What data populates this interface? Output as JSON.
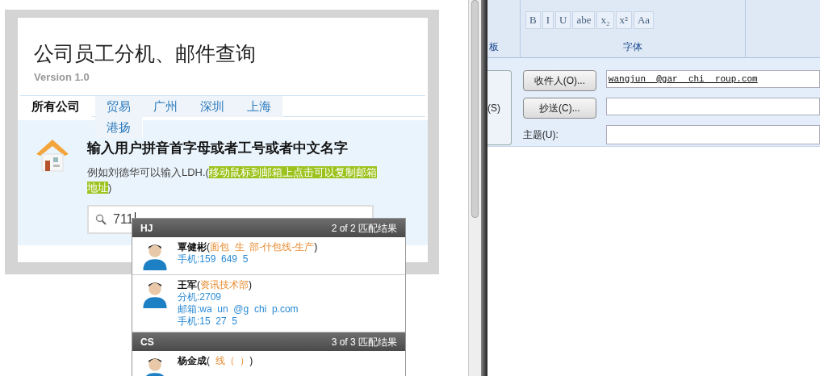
{
  "page": {
    "title": "公司员工分机、邮件查询",
    "version": "Version 1.0",
    "tabs": [
      {
        "label": "所有公司",
        "selected": true
      },
      {
        "label": "贸易",
        "selected": false
      },
      {
        "label": "广州",
        "selected": false
      },
      {
        "label": "深圳",
        "selected": false
      },
      {
        "label": "上海",
        "selected": false
      },
      {
        "label": "港扬",
        "selected": false
      }
    ],
    "prompt": {
      "heading": "输入用户拼音首字母或者工号或者中文名字",
      "hint_before": "例如刘德华可以输入LDH.(",
      "hint_highlight": "移动鼠标到邮箱上点击可以复制邮箱地址",
      "hint_after": ")"
    },
    "search": {
      "value": "711"
    },
    "results": [
      {
        "group": "HJ",
        "count": "2 of 2 匹配结果",
        "people": [
          {
            "name": "覃健彬",
            "open": "(",
            "dept": "面包  生  部-什包线-生产",
            "close": ")",
            "lines": [
              "手机:159  649  5"
            ]
          },
          {
            "name": "王军",
            "open": "(",
            "dept": "资讯技术部",
            "close": ")",
            "lines": [
              "分机:2709",
              "邮箱:wa  un  @g  chi  p.com",
              "手机:15  27  5"
            ]
          }
        ]
      },
      {
        "group": "CS",
        "count": "3 of 3 匹配结果",
        "people": [
          {
            "name": "杨金成",
            "open": "(",
            "dept": "  线（  ）",
            "close": ")"
          }
        ]
      }
    ]
  },
  "mail": {
    "ribbon": {
      "format_buttons": [
        "B",
        "I",
        "U",
        "abe",
        "x₂",
        "x²",
        "Aa"
      ],
      "font_group": "字体",
      "clipboard_group": "板"
    },
    "send_label": "(S)",
    "to_button": "收件人(O)...",
    "to_value": "wangjun  @gar  chi  roup.com",
    "cc_button": "抄送(C)...",
    "subject_label": "主题(U):"
  }
}
